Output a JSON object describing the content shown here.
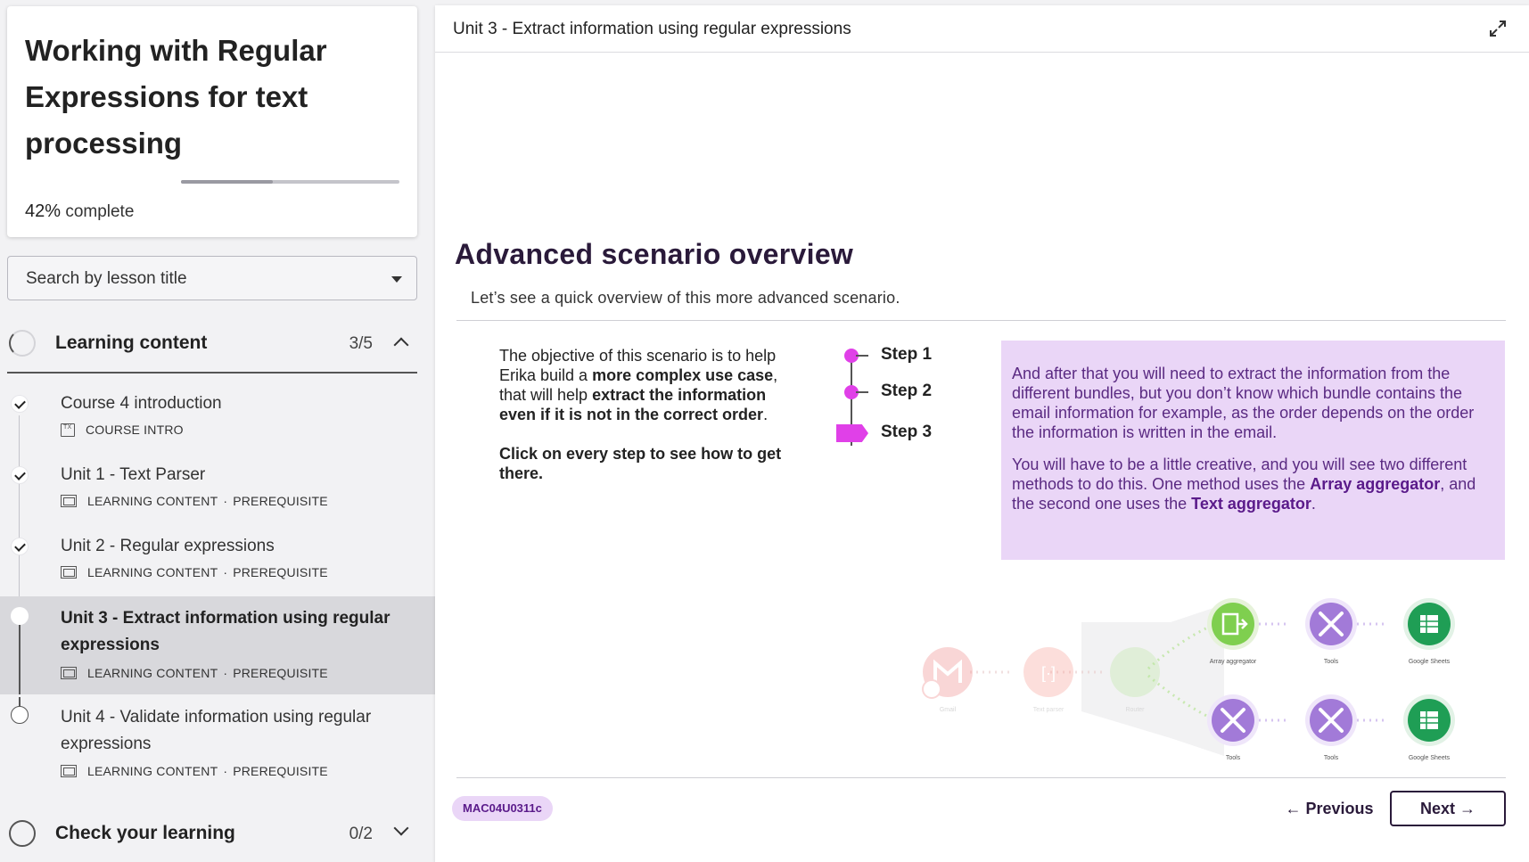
{
  "course": {
    "title": "Working with Regular Expressions for text processing",
    "progress_fraction": 0.42,
    "progress_pct": "42%",
    "progress_suffix": "complete"
  },
  "search": {
    "placeholder": "Search by lesson title"
  },
  "sections": [
    {
      "title": "Learning content",
      "count": "3/5",
      "expanded": true
    },
    {
      "title": "Check your learning",
      "count": "0/2",
      "expanded": false
    }
  ],
  "lessons": [
    {
      "title": "Course 4 introduction",
      "type": "COURSE INTRO",
      "tag": "",
      "status": "done"
    },
    {
      "title": "Unit 1 - Text Parser",
      "type": "LEARNING CONTENT",
      "tag": "PREREQUISITE",
      "status": "done"
    },
    {
      "title": "Unit 2 - Regular expressions",
      "type": "LEARNING CONTENT",
      "tag": "PREREQUISITE",
      "status": "done"
    },
    {
      "title": "Unit 3 - Extract information using regular expressions",
      "type": "LEARNING CONTENT",
      "tag": "PREREQUISITE",
      "status": "current"
    },
    {
      "title": "Unit 4 - Validate information using regular expressions",
      "type": "LEARNING CONTENT",
      "tag": "PREREQUISITE",
      "status": "todo"
    }
  ],
  "meta_separator": "·",
  "main": {
    "unit_title": "Unit 3 - Extract information using regular expressions",
    "heading": "Advanced scenario overview",
    "subheading": "Let’s see a quick overview of this more advanced scenario.",
    "objective": {
      "p1": "The objective of this scenario is to help Erika build a ",
      "b1": "more complex use case",
      "p2": ", that will help ",
      "b2": "extract the information even if it is not in the correct order",
      "p3": ".",
      "cta": "Click on every step to see how to get there."
    },
    "steps": [
      "Step 1",
      "Step 2",
      "Step 3"
    ],
    "info": {
      "para1": "And after that you will need to extract the information from the different bundles, but you don’t know which bundle contains the email information for example, as the order depends on the order the information is written in the email.",
      "para2_a": "You will have to be a little creative, and you will see two different methods to do this. One method uses the ",
      "para2_b1": "Array aggregator",
      "para2_c": ", and the second one uses the ",
      "para2_b2": "Text aggregator",
      "para2_d": "."
    },
    "diagram": {
      "modules": [
        "Gmail",
        "Text parser",
        "Router",
        "Array aggregator",
        "Tools",
        "Google Sheets",
        "Tools",
        "Tools",
        "Google Sheets"
      ]
    },
    "code": "MAC04U0311c",
    "prev_label": "Previous",
    "next_label": "Next"
  },
  "colors": {
    "accent_magenta": "#e040e8",
    "info_bg": "#ead6f7",
    "info_text": "#5a2a82",
    "dark_purple": "#2a1a3a",
    "active_row": "#d8d8dc"
  }
}
